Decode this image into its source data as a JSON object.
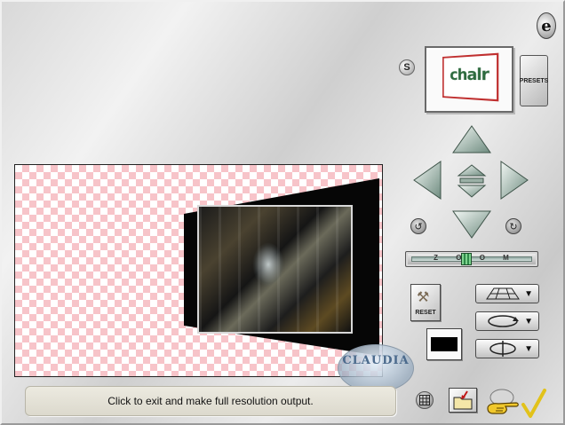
{
  "app": {
    "logo_glyph": "e",
    "status_text": "Click to exit and make full resolution output."
  },
  "preset": {
    "s_label": "S",
    "thumb_text": "chalr",
    "presets_label": "PRESETS"
  },
  "preview": {
    "watermark_text": "CLAUDIA"
  },
  "zoom": {
    "label": "Z O O M"
  },
  "reset": {
    "label": "RESET"
  },
  "colors": {
    "checker_pink": "#f7c4c9",
    "status_bg": "#e6e3d8"
  },
  "icons": {
    "up": "arrow-up-icon",
    "down": "arrow-down-icon",
    "left": "arrow-left-icon",
    "right": "arrow-right-icon",
    "center": "center-pad-icon",
    "rotate_left": "rotate-left-icon",
    "rotate_right": "rotate-right-icon",
    "grid": "grid-icon",
    "folder": "folder-icon",
    "hand": "pointing-hand-icon",
    "checkmark": "checkmark-icon"
  }
}
